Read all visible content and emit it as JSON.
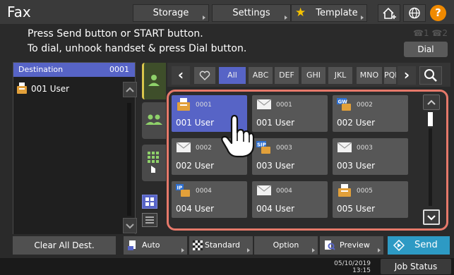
{
  "header": {
    "title": "Fax",
    "storage_label": "Storage",
    "settings_label": "Settings",
    "template_label": "Template"
  },
  "messages": {
    "line1": "Press Send button or START button.",
    "line2": "To dial, unhook handset & press Dial button.",
    "line_status": "☎1 ☎2",
    "dial_label": "Dial"
  },
  "destination": {
    "header_label": "Destination",
    "count": "0001",
    "items": [
      {
        "label": "001 User",
        "icon": "fax-icon"
      }
    ]
  },
  "index_tabs": [
    "All",
    "ABC",
    "DEF",
    "GHI",
    "JKL",
    "MNO",
    "PQRS"
  ],
  "address_book": [
    {
      "num": "0001",
      "name": "001 User",
      "icon": "fax-icon",
      "selected": true
    },
    {
      "num": "0001",
      "name": "001 User",
      "icon": "email-icon",
      "selected": false
    },
    {
      "num": "0002",
      "name": "002 User",
      "icon": "gw-icon",
      "selected": false
    },
    {
      "num": "0002",
      "name": "002 User",
      "icon": "email-icon",
      "selected": false
    },
    {
      "num": "0003",
      "name": "003 User",
      "icon": "sip-icon",
      "selected": false
    },
    {
      "num": "0003",
      "name": "003 User",
      "icon": "email-icon",
      "selected": false
    },
    {
      "num": "0004",
      "name": "004 User",
      "icon": "ip-icon",
      "selected": false
    },
    {
      "num": "0004",
      "name": "004 User",
      "icon": "email-icon",
      "selected": false
    },
    {
      "num": "0005",
      "name": "005 User",
      "icon": "fax-icon",
      "selected": false
    }
  ],
  "toolbar": {
    "clear_label": "Clear All Dest.",
    "auto_label": "Auto",
    "standard_label": "Standard",
    "option_label": "Option",
    "preview_label": "Preview",
    "send_label": "Send"
  },
  "status": {
    "date": "05/10/2019",
    "time": "13:15",
    "job_status_label": "Job Status"
  },
  "colors": {
    "accent": "#5764c6",
    "highlight_frame": "#e6796a",
    "send": "#2d9ac4",
    "help": "#f08a00"
  }
}
